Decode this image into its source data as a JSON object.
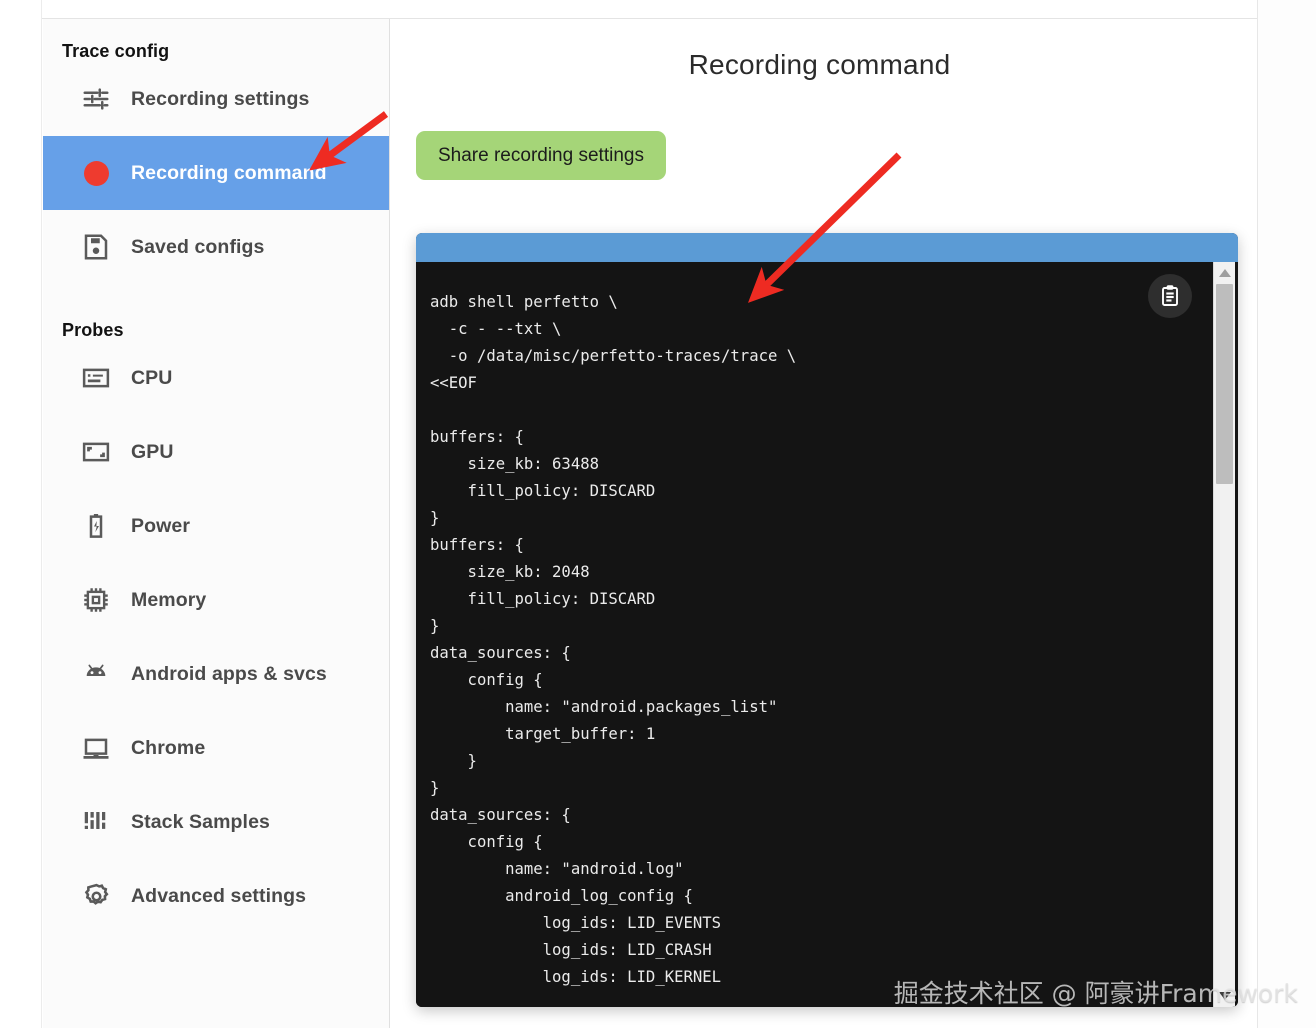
{
  "sidebar": {
    "trace_config_title": "Trace config",
    "probes_title": "Probes",
    "trace_config_items": [
      {
        "label": "Recording settings",
        "icon": "tune-icon",
        "selected": false
      },
      {
        "label": "Recording command",
        "icon": "record-dot-icon",
        "selected": true
      },
      {
        "label": "Saved configs",
        "icon": "save-disk-icon",
        "selected": false
      }
    ],
    "probe_items": [
      {
        "label": "CPU",
        "icon": "cpu-icon"
      },
      {
        "label": "GPU",
        "icon": "gpu-icon"
      },
      {
        "label": "Power",
        "icon": "battery-icon"
      },
      {
        "label": "Memory",
        "icon": "memory-chip-icon"
      },
      {
        "label": "Android apps & svcs",
        "icon": "android-icon"
      },
      {
        "label": "Chrome",
        "icon": "laptop-icon"
      },
      {
        "label": "Stack Samples",
        "icon": "stack-samples-icon"
      },
      {
        "label": "Advanced settings",
        "icon": "gear-icon"
      }
    ]
  },
  "main": {
    "page_title": "Recording command",
    "share_button_label": "Share recording settings",
    "copy_icon": "clipboard-copy-icon",
    "code": "adb shell perfetto \\\n  -c - --txt \\\n  -o /data/misc/perfetto-traces/trace \\\n<<EOF\n\nbuffers: {\n    size_kb: 63488\n    fill_policy: DISCARD\n}\nbuffers: {\n    size_kb: 2048\n    fill_policy: DISCARD\n}\ndata_sources: {\n    config {\n        name: \"android.packages_list\"\n        target_buffer: 1\n    }\n}\ndata_sources: {\n    config {\n        name: \"android.log\"\n        android_log_config {\n            log_ids: LID_EVENTS\n            log_ids: LID_CRASH\n            log_ids: LID_KERNEL"
  },
  "scrollbar": {
    "up_arrow": "scroll-up-arrow-icon",
    "down_arrow": "scroll-down-arrow-icon"
  },
  "annotations": {
    "arrow_1": "red-arrow-to-recording-command",
    "arrow_2": "red-arrow-to-code-block"
  },
  "watermark": "掘金技术社区 @ 阿豪讲Framework",
  "colors": {
    "selected_nav": "#66a0e8",
    "record_dot": "#ee3b2f",
    "share_button": "#a5d578",
    "code_header": "#5b9bd5",
    "code_background": "#141414",
    "arrow": "#ee2b22"
  }
}
